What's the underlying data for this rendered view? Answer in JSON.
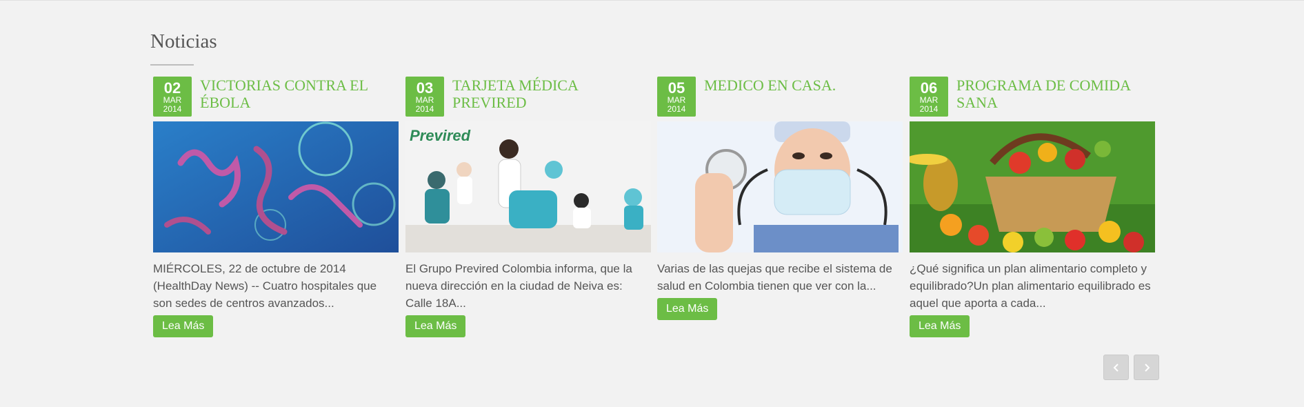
{
  "section": {
    "title": "Noticias"
  },
  "news": [
    {
      "day": "02",
      "month": "MAR",
      "year": "2014",
      "title": "VICTORIAS CONTRA EL ÉBOLA",
      "excerpt": "MIÉRCOLES, 22 de octubre de 2014 (HealthDay News) -- Cuatro hospitales que son sedes de centros avanzados...",
      "button": "Lea Más",
      "image": "ebola-virus-image"
    },
    {
      "day": "03",
      "month": "MAR",
      "year": "2014",
      "title": "TARJETA MÉDICA PREVIRED",
      "excerpt": "El Grupo Previred Colombia informa, que la nueva dirección en la ciudad de Neiva es: Calle 18A...",
      "button": "Lea Más",
      "image": "doctor-with-children-image",
      "image_logo": "Previred"
    },
    {
      "day": "05",
      "month": "MAR",
      "year": "2014",
      "title": "MEDICO EN CASA.",
      "excerpt": "Varias de las quejas que recibe el sistema de salud en Colombia tienen que ver con la...",
      "button": "Lea Más",
      "image": "doctor-stethoscope-image"
    },
    {
      "day": "06",
      "month": "MAR",
      "year": "2014",
      "title": "PROGRAMA DE COMIDA SANA",
      "excerpt": "¿Qué significa un plan alimentario completo y equilibrado?Un plan alimentario equilibrado es aquel que aporta a cada...",
      "button": "Lea Más",
      "image": "fruit-basket-image"
    }
  ],
  "pager": {
    "prev_icon": "chevron-left-icon",
    "next_icon": "chevron-right-icon"
  },
  "colors": {
    "accent": "#6cbd45",
    "text": "#555555",
    "background": "#f2f2f2"
  }
}
